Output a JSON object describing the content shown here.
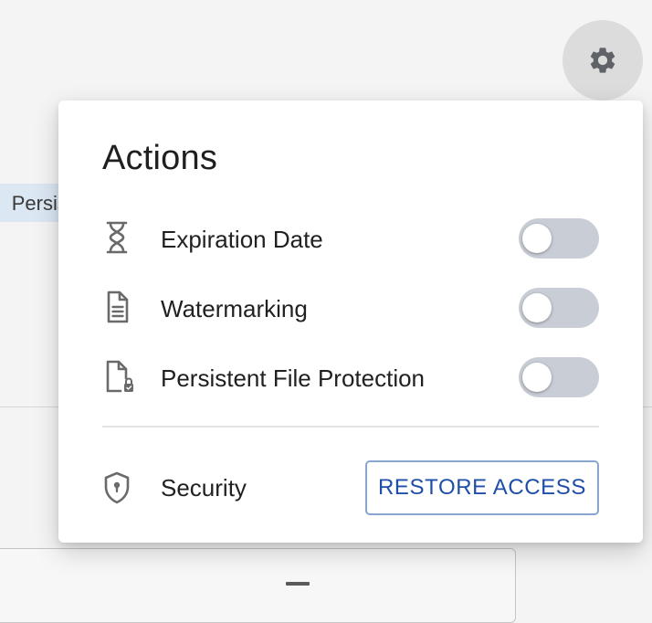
{
  "background": {
    "chip_text": "Persist"
  },
  "settings_button": {
    "icon": "gear-icon"
  },
  "panel": {
    "title": "Actions",
    "actions": [
      {
        "label": "Expiration Date",
        "icon": "hourglass-icon",
        "enabled": false
      },
      {
        "label": "Watermarking",
        "icon": "document-icon",
        "enabled": false
      },
      {
        "label": "Persistent File Protection",
        "icon": "locked-file-icon",
        "enabled": false
      }
    ],
    "security": {
      "label": "Security",
      "icon": "shield-icon",
      "button_label": "RESTORE ACCESS"
    }
  },
  "colors": {
    "accent": "#1f4fa8",
    "toggle_off_track": "#c9cdd6",
    "gear_button_bg": "#dcdcdc",
    "chip_bg": "#dbe7f3"
  }
}
